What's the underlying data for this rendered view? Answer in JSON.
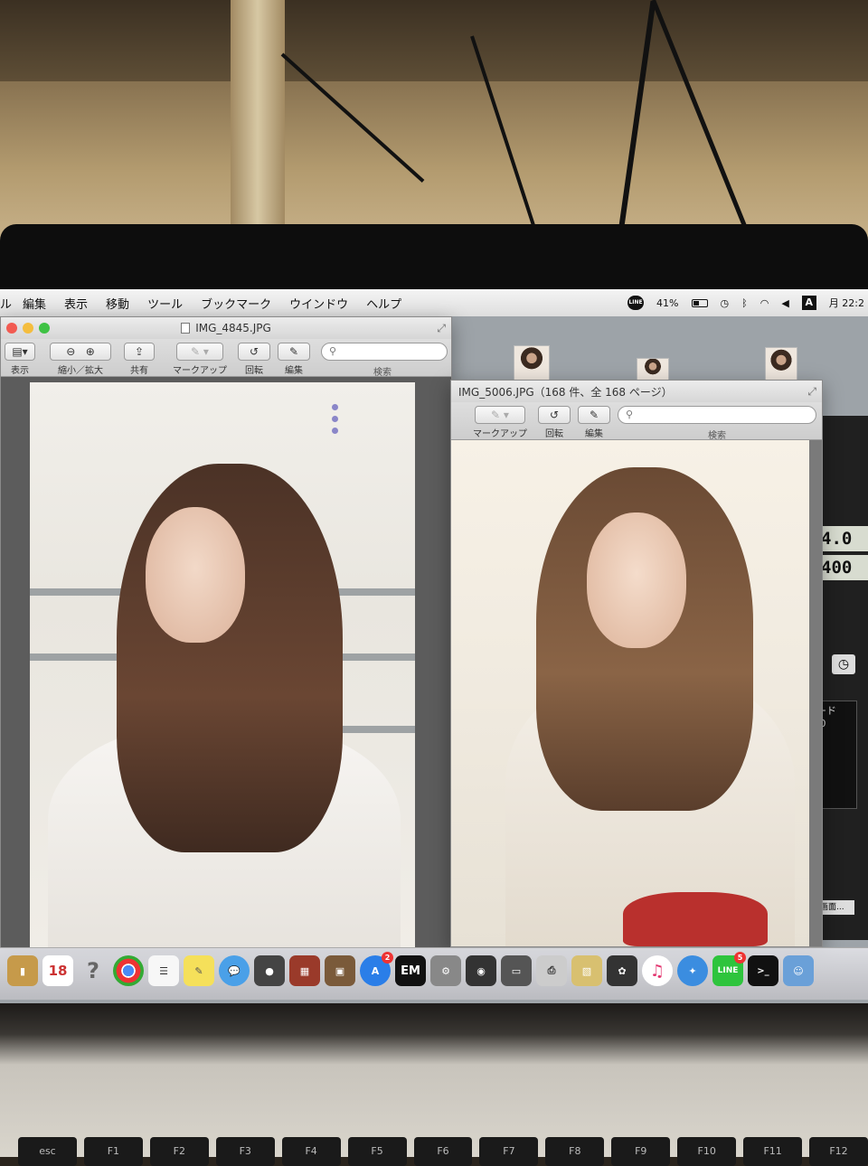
{
  "menubar": {
    "items": [
      "ル",
      "編集",
      "表示",
      "移動",
      "ツール",
      "ブックマーク",
      "ウインドウ",
      "ヘルプ"
    ],
    "status": {
      "line": "LINE",
      "battery": "41%",
      "input": "A",
      "clock": "月 22:2"
    }
  },
  "window1": {
    "title": "IMG_4845.JPG",
    "toolbar": {
      "view_label": "表示",
      "zoom_label": "縮小／拡大",
      "share_label": "共有",
      "markup_label": "マークアップ",
      "rotate_label": "回転",
      "edit_label": "編集",
      "search_label": "検索"
    }
  },
  "window2": {
    "title": "IMG_5006.JPG（168 件、全 168 ページ）",
    "toolbar": {
      "markup_label": "マークアップ",
      "rotate_label": "回転",
      "edit_label": "編集",
      "search_label": "検索"
    }
  },
  "camera_panel": {
    "aperture": "4.0",
    "iso": "400",
    "mode_label": "ード",
    "value": ",0",
    "screen_label": "画面..."
  },
  "dock": {
    "calendar_day": "18",
    "mail_badge": "2",
    "line_badge": "5",
    "em_label": "EM"
  },
  "keyboard": {
    "keys": [
      "esc",
      "F1",
      "F2",
      "F3",
      "F4",
      "F5",
      "F6",
      "F7",
      "F8",
      "F9",
      "F10",
      "F11",
      "F12"
    ]
  }
}
